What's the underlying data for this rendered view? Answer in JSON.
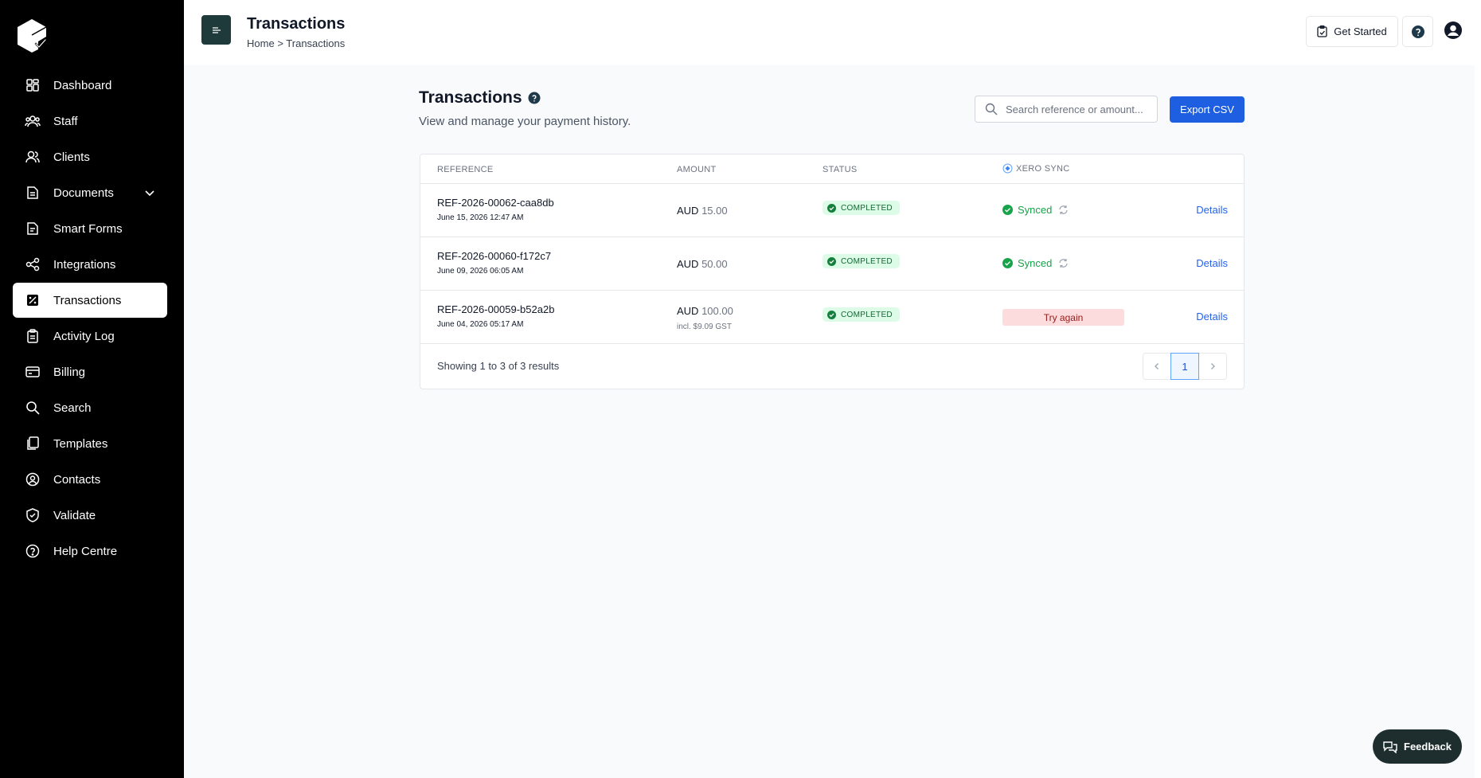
{
  "sidebar": {
    "items": [
      {
        "label": "Dashboard",
        "icon": "dashboard-icon"
      },
      {
        "label": "Staff",
        "icon": "staff-icon"
      },
      {
        "label": "Clients",
        "icon": "clients-icon"
      },
      {
        "label": "Documents",
        "icon": "documents-icon"
      },
      {
        "label": "Smart Forms",
        "icon": "smart-forms-icon"
      },
      {
        "label": "Integrations",
        "icon": "integrations-icon"
      },
      {
        "label": "Transactions",
        "icon": "transactions-icon"
      },
      {
        "label": "Activity Log",
        "icon": "activity-log-icon"
      },
      {
        "label": "Billing",
        "icon": "billing-icon"
      },
      {
        "label": "Search",
        "icon": "search-icon"
      },
      {
        "label": "Templates",
        "icon": "templates-icon"
      },
      {
        "label": "Contacts",
        "icon": "contacts-icon"
      },
      {
        "label": "Validate",
        "icon": "validate-icon"
      },
      {
        "label": "Help Centre",
        "icon": "help-centre-icon"
      }
    ]
  },
  "header": {
    "title": "Transactions",
    "breadcrumb_home": "Home",
    "breadcrumb_sep": ">",
    "breadcrumb_current": "Transactions",
    "get_started": "Get Started"
  },
  "main": {
    "title": "Transactions",
    "subtitle": "View and manage your payment history.",
    "search_placeholder": "Search reference or amount...",
    "export_label": "Export CSV",
    "columns": {
      "reference": "REFERENCE",
      "amount": "AMOUNT",
      "status": "STATUS",
      "sync": "XERO SYNC"
    },
    "rows": [
      {
        "reference": "REF-2026-00062-caa8db",
        "date": "June 15, 2026 12:47 AM",
        "currency": "AUD",
        "amount": "15.00",
        "gst": "",
        "status": "COMPLETED",
        "sync": "Synced",
        "action": "Details"
      },
      {
        "reference": "REF-2026-00060-f172c7",
        "date": "June 09, 2026 06:05 AM",
        "currency": "AUD",
        "amount": "50.00",
        "gst": "",
        "status": "COMPLETED",
        "sync": "Synced",
        "action": "Details"
      },
      {
        "reference": "REF-2026-00059-b52a2b",
        "date": "June 04, 2026 05:17 AM",
        "currency": "AUD",
        "amount": "100.00",
        "gst": "incl. $9.09 GST",
        "status": "COMPLETED",
        "sync": "Try again",
        "action": "Details"
      }
    ],
    "results_text": "Showing 1 to 3 of 3 results",
    "current_page": "1"
  },
  "feedback_label": "Feedback",
  "colors": {
    "sidebar_bg": "#000000",
    "accent": "#1d5fe0",
    "success": "#16a34a",
    "danger_bg": "#fcdcdc"
  }
}
